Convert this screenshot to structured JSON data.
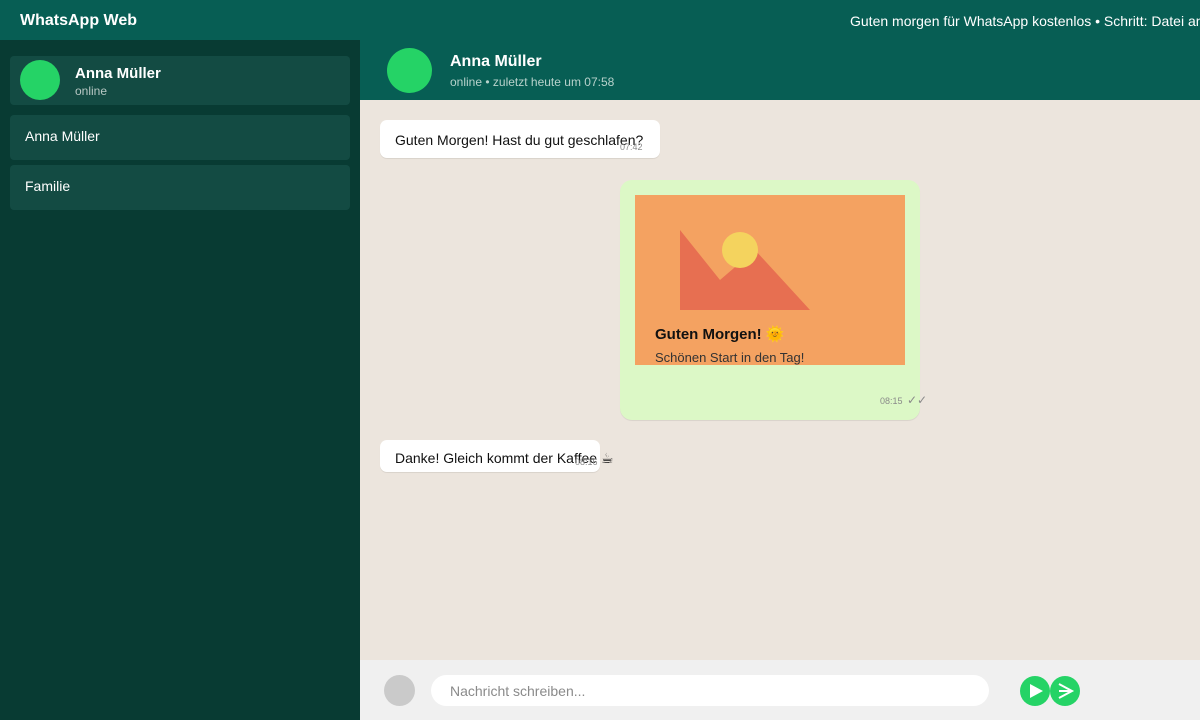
{
  "app": {
    "title": "WhatsApp Web",
    "marquee": "Guten morgen für WhatsApp kostenlos • Schritt: Datei an",
    "colors": {
      "topbar": "#075e54",
      "sidebar": "#083b33",
      "sidebar_item": "#134b43",
      "accent": "#25d366",
      "chat_bg": "#ece5dd",
      "outgoing_bubble": "#dcf8c6",
      "image_bg": "#f4a261"
    }
  },
  "sidebar": {
    "profile": {
      "name": "Anna Müller",
      "status": "online"
    },
    "chats": [
      {
        "label": "Anna Müller"
      },
      {
        "label": "Familie"
      }
    ]
  },
  "chat": {
    "header": {
      "name": "Anna Müller",
      "last_seen": "online • zuletzt heute um 07:58"
    },
    "messages": [
      {
        "direction": "in",
        "text": "Guten Morgen! Hast du gut geschlafen?",
        "time": "07:42"
      },
      {
        "direction": "out",
        "type": "image",
        "card_title": "Guten Morgen! 🌞",
        "card_subtitle": "Schönen Start in den Tag!",
        "time": "08:15",
        "ticks": "✓✓"
      },
      {
        "direction": "in",
        "text": "Danke! Gleich kommt der Kaffee ☕",
        "time": "08:16"
      }
    ]
  },
  "composer": {
    "placeholder": "Nachricht schreiben...",
    "value": "",
    "icons": [
      "attach-icon",
      "send-icon",
      "send-icon"
    ]
  }
}
